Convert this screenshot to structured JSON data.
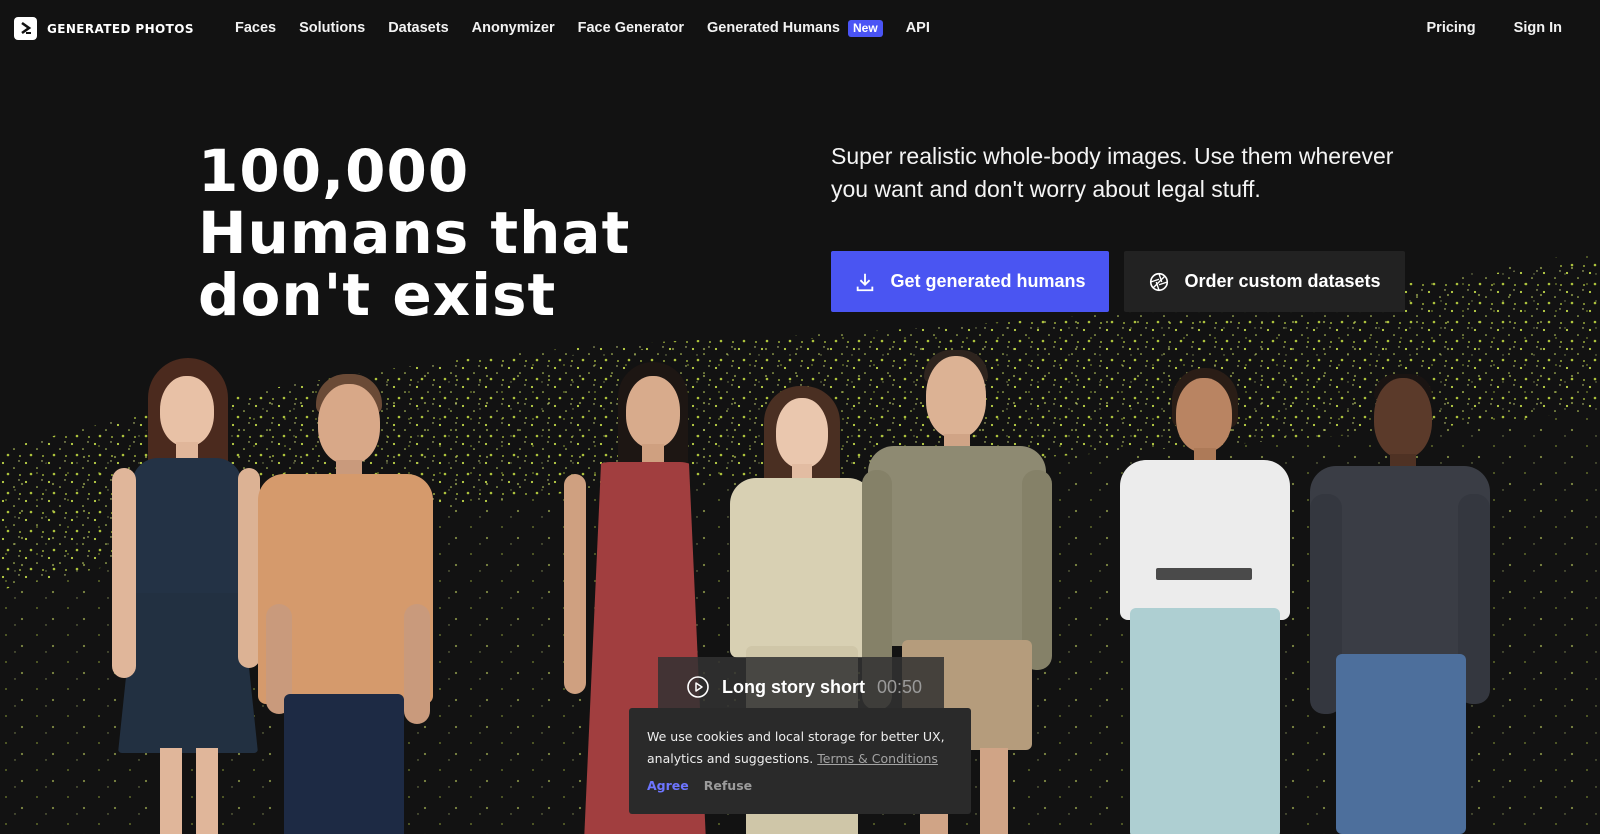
{
  "brand": {
    "name": "GENERATED PHOTOS",
    "logo_icon": "chevron-right-icon"
  },
  "nav": {
    "links": [
      "Faces",
      "Solutions",
      "Datasets",
      "Anonymizer",
      "Face Generator",
      "Generated Humans",
      "API"
    ],
    "new_badge": "New",
    "pricing": "Pricing",
    "sign_in": "Sign In"
  },
  "hero": {
    "title_lines": [
      "100,000",
      "Humans that",
      "don't exist"
    ],
    "subtitle": "Super realistic whole-body images. Use them wherever you want and don't worry about legal stuff.",
    "primary_button": "Get generated humans",
    "primary_icon": "download-icon",
    "secondary_button": "Order custom datasets",
    "secondary_icon": "aperture-icon"
  },
  "video": {
    "title": "Long story short",
    "duration": "00:50",
    "icon": "play-circle-icon"
  },
  "cookie": {
    "text": "We use cookies and local storage for better UX, analytics and suggestions.",
    "link": "Terms & Conditions",
    "agree": "Agree",
    "refuse": "Refuse"
  },
  "colors": {
    "background": "#121212",
    "accent": "#4a55f2",
    "sparkle": "#c8e04a"
  }
}
